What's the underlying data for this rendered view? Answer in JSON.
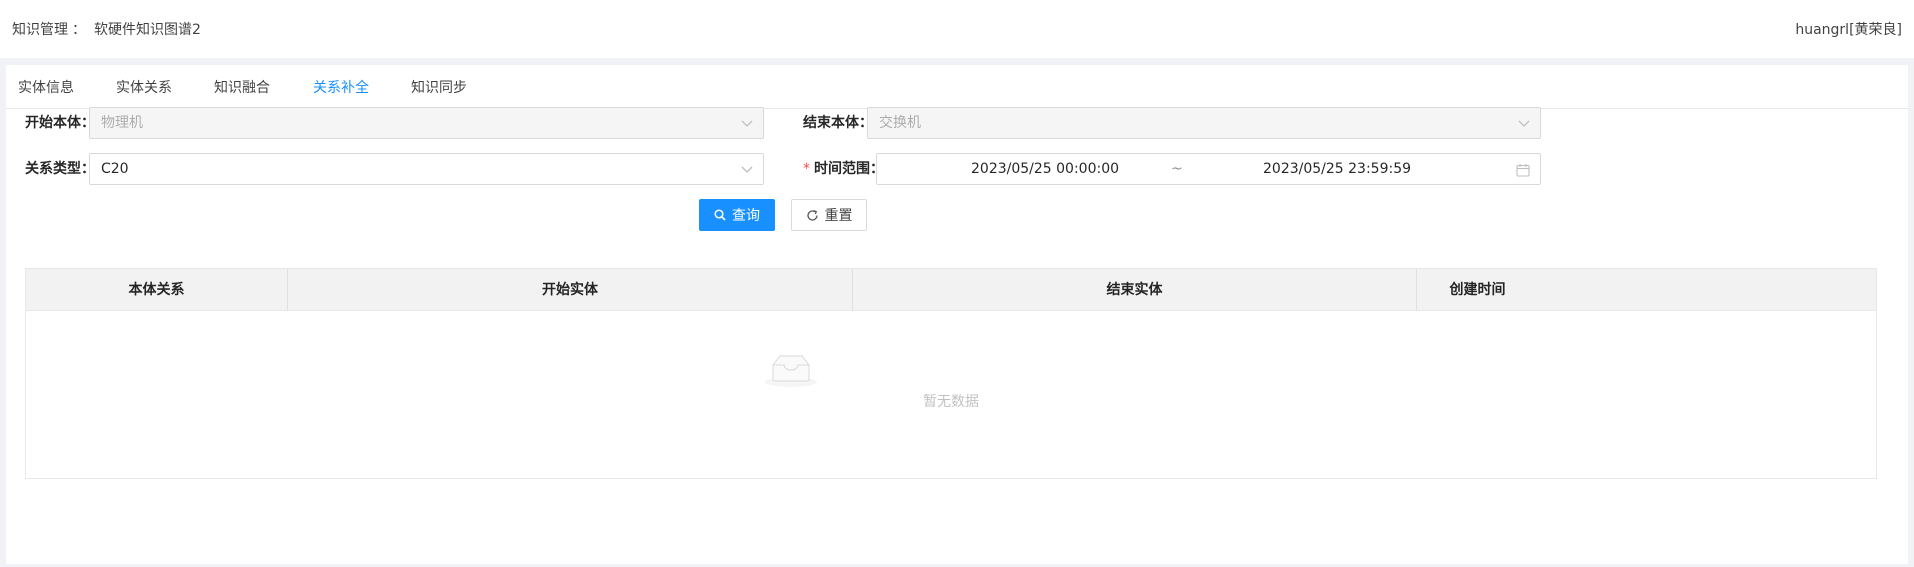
{
  "header": {
    "breadcrumb_root": "知识管理",
    "breadcrumb_sep": "：",
    "breadcrumb_current": "软硬件知识图谱2",
    "user": "huangrl[黄荣良]"
  },
  "tabs": [
    {
      "label": "实体信息",
      "active": false
    },
    {
      "label": "实体关系",
      "active": false
    },
    {
      "label": "知识融合",
      "active": false
    },
    {
      "label": "关系补全",
      "active": true
    },
    {
      "label": "知识同步",
      "active": false
    }
  ],
  "form": {
    "start_ontology_label": "开始本体：",
    "start_ontology_value": "物理机",
    "end_ontology_label": "结束本体：",
    "end_ontology_value": "交换机",
    "relation_type_label": "关系类型：",
    "relation_type_value": "C20",
    "time_range_label": "时间范围：",
    "time_range_required": "*",
    "time_start": "2023/05/25 00:00:00",
    "time_separator": "~",
    "time_end": "2023/05/25 23:59:59"
  },
  "buttons": {
    "search": "查询",
    "reset": "重置"
  },
  "table": {
    "columns": [
      "本体关系",
      "开始实体",
      "结束实体",
      "创建时间"
    ],
    "rows": [],
    "empty_text": "暂无数据"
  },
  "colors": {
    "primary": "#1890ff",
    "required": "#ff4d4f"
  }
}
